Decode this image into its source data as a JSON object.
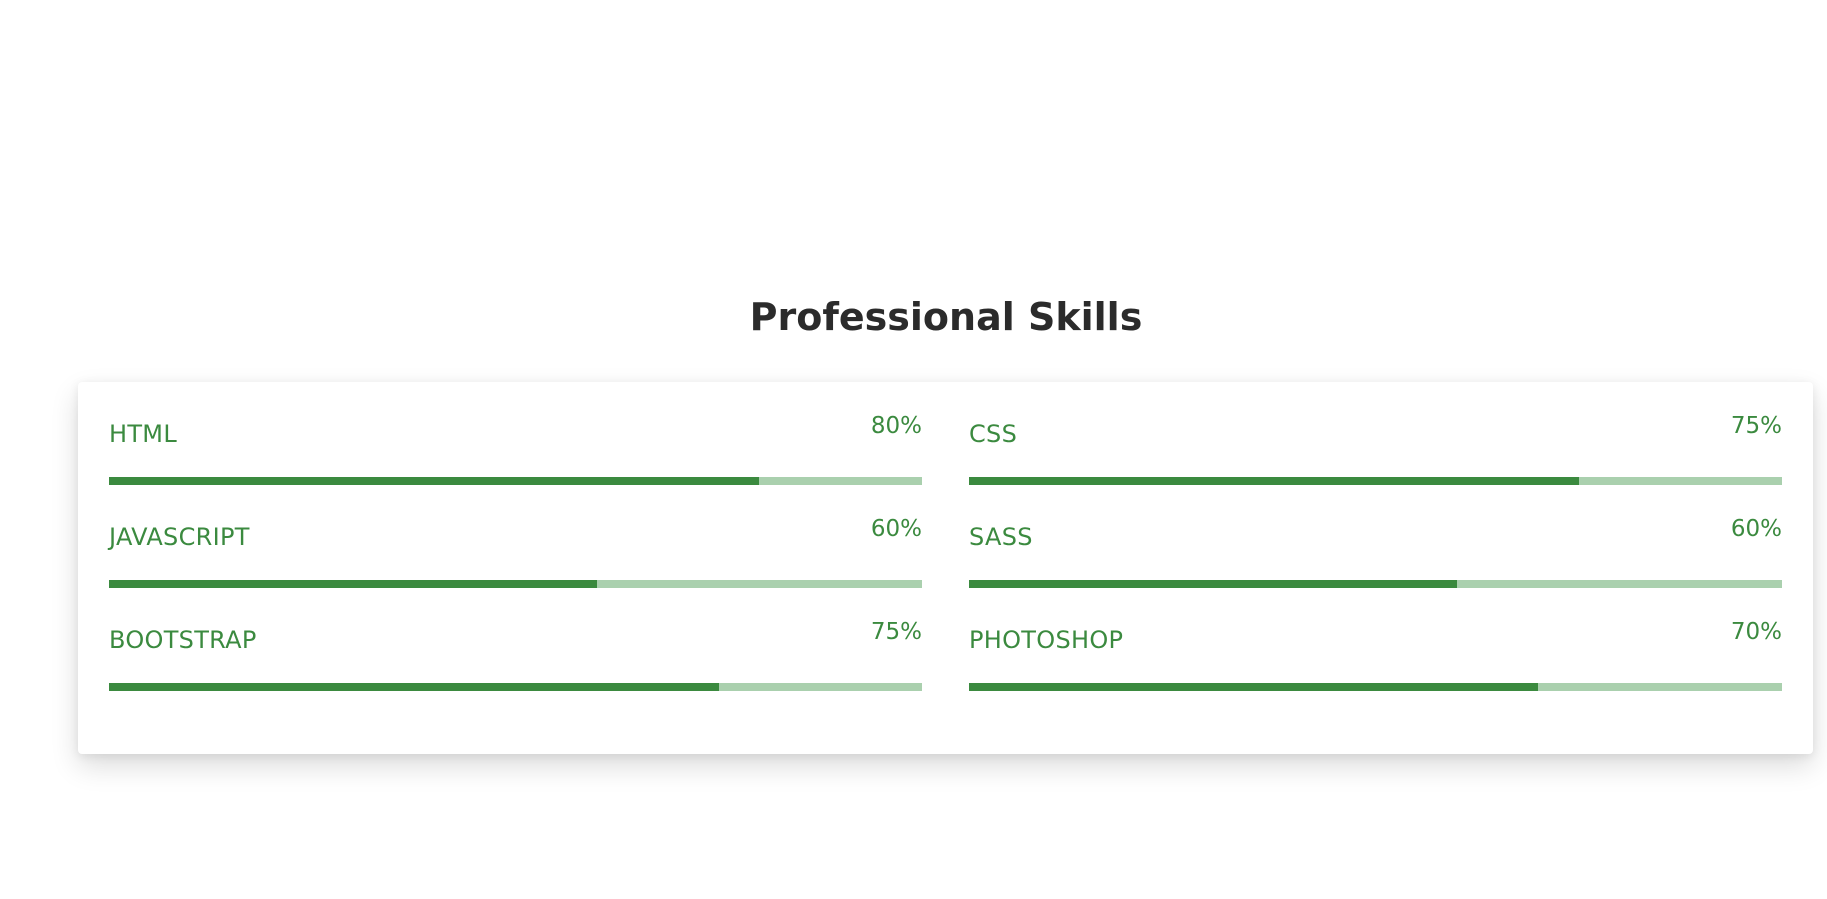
{
  "section": {
    "title": "Professional Skills"
  },
  "colors": {
    "accent": "#3b8a3f",
    "track": "#aad0ae",
    "title": "#2b2b2b"
  },
  "skills": [
    {
      "name": "HTML",
      "percent_label": "80%",
      "level": 0.8
    },
    {
      "name": "CSS",
      "percent_label": "75%",
      "level": 0.75
    },
    {
      "name": "JAVASCRIPT",
      "percent_label": "60%",
      "level": 0.6
    },
    {
      "name": "SASS",
      "percent_label": "60%",
      "level": 0.6
    },
    {
      "name": "BOOTSTRAP",
      "percent_label": "75%",
      "level": 0.75
    },
    {
      "name": "PHOTOSHOP",
      "percent_label": "70%",
      "level": 0.7
    }
  ]
}
